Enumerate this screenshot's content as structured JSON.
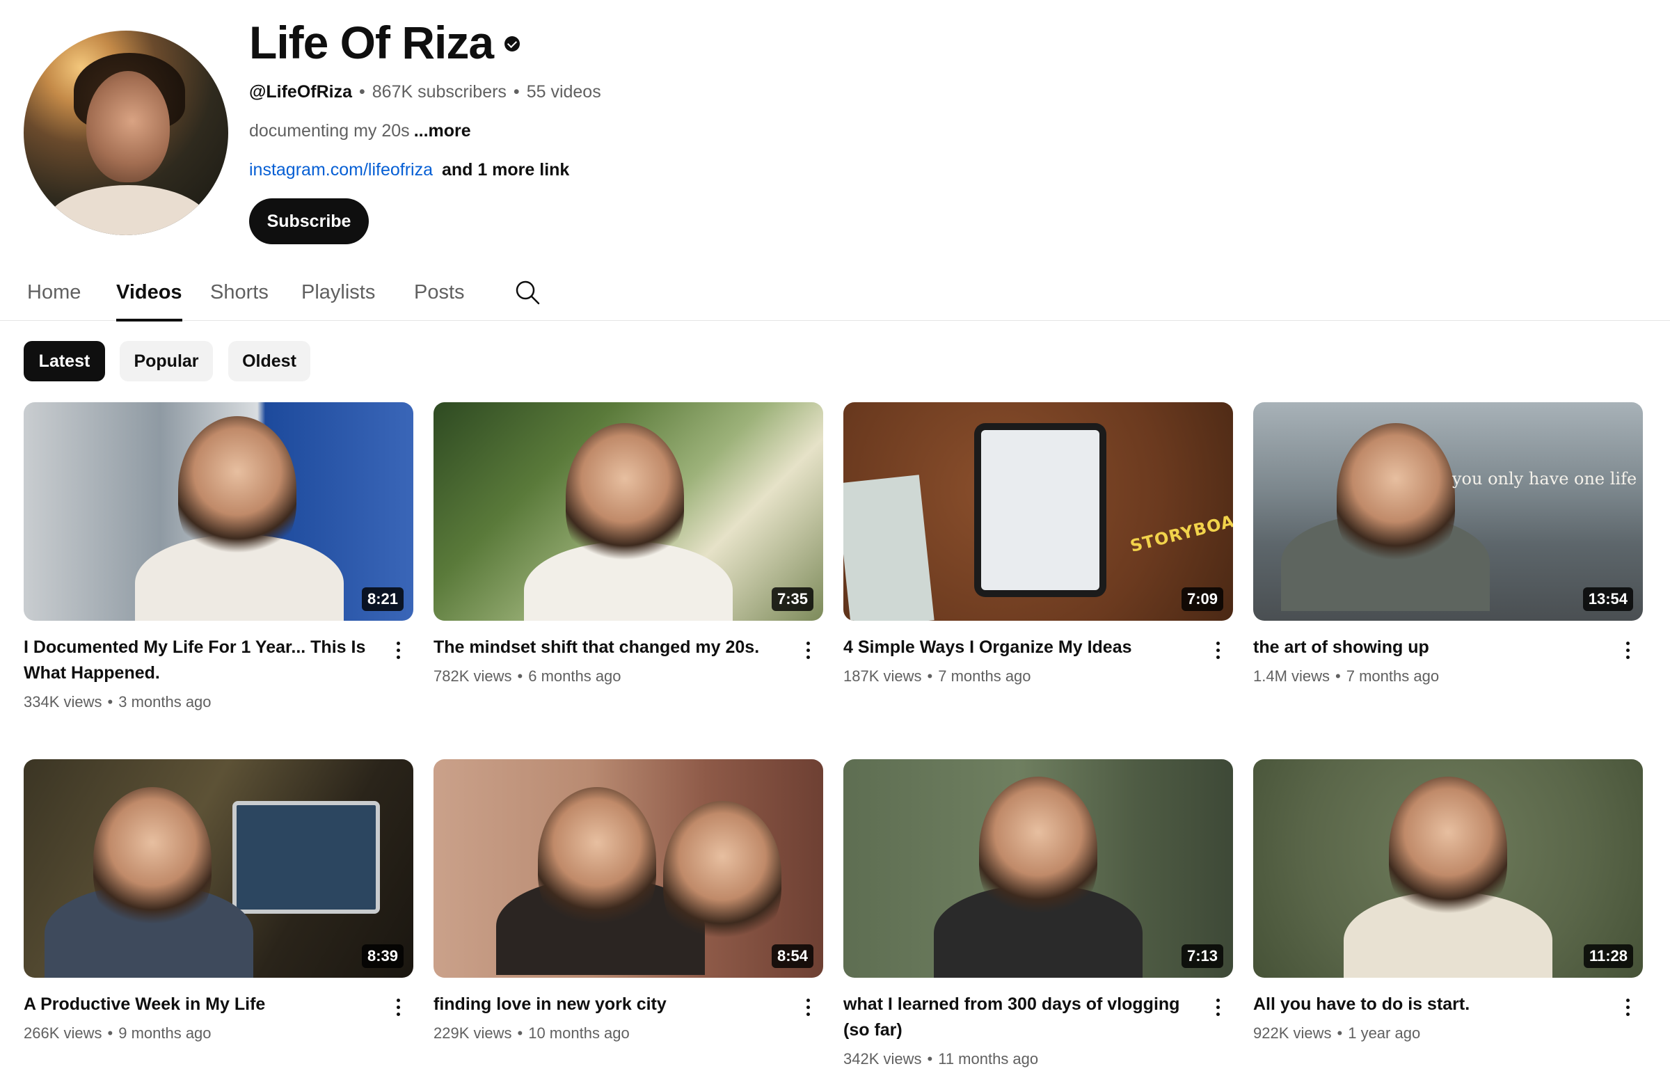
{
  "channel": {
    "name": "Life Of Riza",
    "handle": "@LifeOfRiza",
    "subscribers": "867K subscribers",
    "videos_count": "55 videos",
    "separator": "•",
    "description": "documenting my 20s",
    "more_label": "...more",
    "link_text": "instagram.com/lifeofriza",
    "more_links": "and 1 more link",
    "subscribe_label": "Subscribe",
    "verified_icon": "verified-check-icon"
  },
  "tabs": [
    {
      "label": "Home"
    },
    {
      "label": "Videos",
      "active": true
    },
    {
      "label": "Shorts"
    },
    {
      "label": "Playlists"
    },
    {
      "label": "Posts"
    }
  ],
  "chips": [
    {
      "label": "Latest",
      "active": true
    },
    {
      "label": "Popular"
    },
    {
      "label": "Oldest"
    }
  ],
  "videos": [
    {
      "title": "I Documented My Life For 1 Year... This Is What Happened.",
      "views": "334K views",
      "age": "3 months ago",
      "duration": "8:21"
    },
    {
      "title": "The mindset shift that changed my 20s.",
      "views": "782K views",
      "age": "6 months ago",
      "duration": "7:35"
    },
    {
      "title": "4 Simple Ways I Organize My Ideas",
      "views": "187K views",
      "age": "7 months ago",
      "duration": "7:09",
      "overlay": "STORYBOARD"
    },
    {
      "title": "the art of showing up",
      "views": "1.4M views",
      "age": "7 months ago",
      "duration": "13:54",
      "overlay": "you only have one life"
    },
    {
      "title": "A Productive Week in My Life",
      "views": "266K views",
      "age": "9 months ago",
      "duration": "8:39"
    },
    {
      "title": "finding love in new york city",
      "views": "229K views",
      "age": "10 months ago",
      "duration": "8:54"
    },
    {
      "title": "what I learned from 300 days of vlogging (so far)",
      "views": "342K views",
      "age": "11 months ago",
      "duration": "7:13"
    },
    {
      "title": "All you have to do is start.",
      "views": "922K views",
      "age": "1 year ago",
      "duration": "11:28"
    }
  ],
  "colors": {
    "text_primary": "#0f0f0f",
    "text_secondary": "#606060",
    "link": "#065fd4",
    "chip_bg": "#f2f2f2"
  }
}
